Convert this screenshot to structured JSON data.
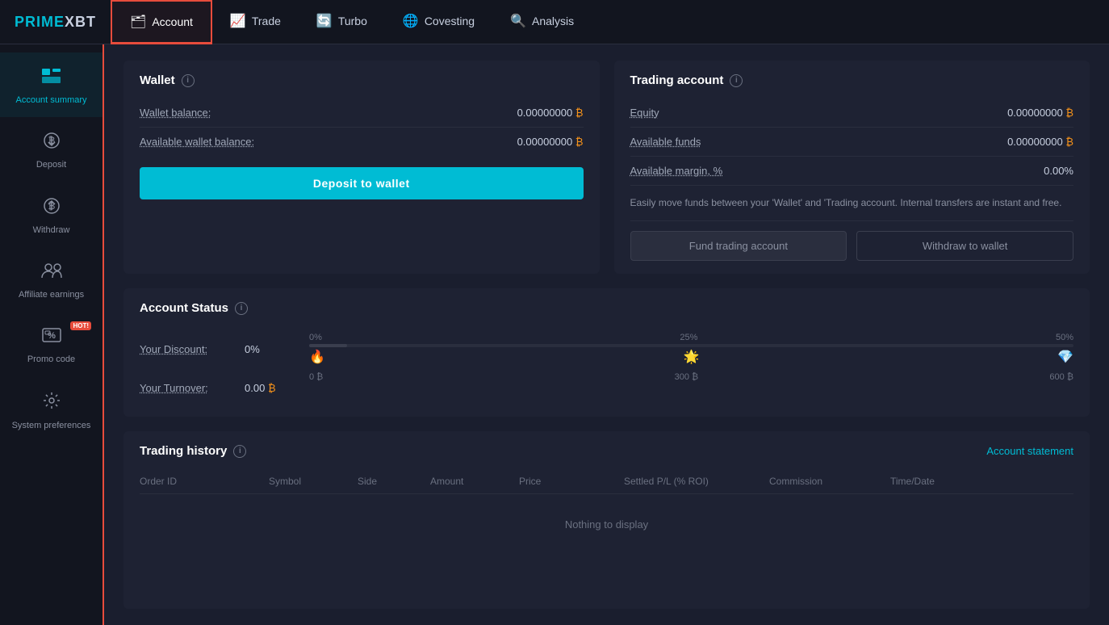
{
  "app": {
    "logo_prime": "PRIME",
    "logo_xbt": "XBT"
  },
  "nav": {
    "items": [
      {
        "id": "account",
        "label": "Account",
        "active": true
      },
      {
        "id": "trade",
        "label": "Trade",
        "active": false
      },
      {
        "id": "turbo",
        "label": "Turbo",
        "active": false
      },
      {
        "id": "covesting",
        "label": "Covesting",
        "active": false
      },
      {
        "id": "analysis",
        "label": "Analysis",
        "active": false
      }
    ]
  },
  "sidebar": {
    "items": [
      {
        "id": "account-summary",
        "label": "Account summary",
        "icon": "📊",
        "active": true
      },
      {
        "id": "deposit",
        "label": "Deposit",
        "icon": "⬇",
        "active": false
      },
      {
        "id": "withdraw",
        "label": "Withdraw",
        "icon": "⬆",
        "active": false
      },
      {
        "id": "affiliate",
        "label": "Affiliate earnings",
        "icon": "👥",
        "active": false
      },
      {
        "id": "promo",
        "label": "Promo code",
        "icon": "%",
        "active": false,
        "badge": "HOT!"
      },
      {
        "id": "system",
        "label": "System preferences",
        "icon": "⚙",
        "active": false
      }
    ]
  },
  "wallet": {
    "title": "Wallet",
    "wallet_balance_label": "Wallet balance:",
    "wallet_balance_value": "0.00000000",
    "available_wallet_label": "Available wallet balance:",
    "available_wallet_value": "0.00000000",
    "deposit_btn": "Deposit to wallet",
    "btc_symbol": "₿"
  },
  "trading_account": {
    "title": "Trading account",
    "equity_label": "Equity",
    "equity_value": "0.00000000",
    "available_funds_label": "Available funds",
    "available_funds_value": "0.00000000",
    "available_margin_label": "Available margin, %",
    "available_margin_value": "0.00%",
    "transfer_desc": "Easily move funds between your 'Wallet' and 'Trading account. Internal transfers are instant and free.",
    "fund_btn": "Fund trading account",
    "withdraw_btn": "Withdraw to wallet",
    "btc_symbol": "₿"
  },
  "account_status": {
    "title": "Account Status",
    "discount_label": "Your Discount:",
    "discount_value": "0%",
    "turnover_label": "Your Turnover:",
    "turnover_value": "0.00",
    "btc_symbol": "₿",
    "tiers": [
      "0%",
      "25%",
      "50%"
    ],
    "tier_values": [
      "0 ₿",
      "300 ₿",
      "600 ₿"
    ]
  },
  "trading_history": {
    "title": "Trading history",
    "account_statement": "Account statement",
    "columns": [
      "Order ID",
      "Symbol",
      "Side",
      "Amount",
      "Price",
      "Settled P/L (% ROI)",
      "Commission",
      "Time/Date"
    ],
    "empty_message": "Nothing to display"
  }
}
